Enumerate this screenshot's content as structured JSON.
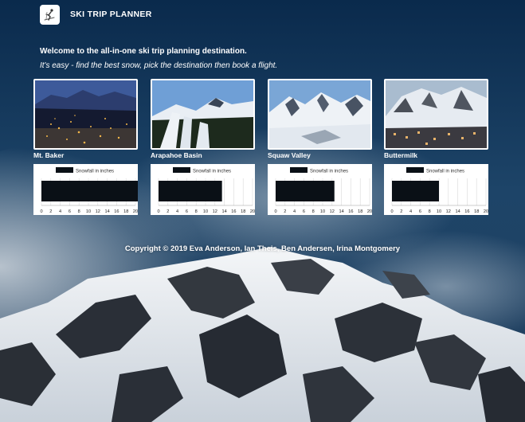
{
  "header": {
    "brand": "SKI TRIP PLANNER",
    "logo_icon": "skier-icon"
  },
  "intro": {
    "line1": "Welcome to the all-in-one ski trip planning destination.",
    "line2": "It's easy - find the best snow, pick the destination then book a flight."
  },
  "resorts": [
    {
      "name": "Mt. Baker",
      "scene": "night-town"
    },
    {
      "name": "Arapahoe Basin",
      "scene": "ski-runs"
    },
    {
      "name": "Squaw Valley",
      "scene": "snowy-valley"
    },
    {
      "name": "Buttermilk",
      "scene": "mountain-town"
    }
  ],
  "chart_data": [
    {
      "type": "bar",
      "orientation": "horizontal",
      "title": "",
      "series": [
        {
          "name": "Snowfall in inches",
          "values": [
            21
          ]
        }
      ],
      "xlim": [
        0,
        20
      ],
      "xticks": [
        0,
        2,
        4,
        6,
        8,
        10,
        12,
        14,
        16,
        18,
        20
      ],
      "grid": true,
      "legend": "top",
      "color": "#0a1016"
    },
    {
      "type": "bar",
      "orientation": "horizontal",
      "title": "",
      "series": [
        {
          "name": "Snowfall in inches",
          "values": [
            13.5
          ]
        }
      ],
      "xlim": [
        0,
        20
      ],
      "xticks": [
        0,
        2,
        4,
        6,
        8,
        10,
        12,
        14,
        16,
        18,
        20
      ],
      "grid": true,
      "legend": "top",
      "color": "#0a1016"
    },
    {
      "type": "bar",
      "orientation": "horizontal",
      "title": "",
      "series": [
        {
          "name": "Snowfall in inches",
          "values": [
            12.5
          ]
        }
      ],
      "xlim": [
        0,
        20
      ],
      "xticks": [
        0,
        2,
        4,
        6,
        8,
        10,
        12,
        14,
        16,
        18,
        20
      ],
      "grid": true,
      "legend": "top",
      "color": "#0a1016"
    },
    {
      "type": "bar",
      "orientation": "horizontal",
      "title": "",
      "series": [
        {
          "name": "Snowfall in inches",
          "values": [
            10
          ]
        }
      ],
      "xlim": [
        0,
        20
      ],
      "xticks": [
        0,
        2,
        4,
        6,
        8,
        10,
        12,
        14,
        16,
        18,
        20
      ],
      "grid": true,
      "legend": "top",
      "color": "#0a1016"
    }
  ],
  "footer": {
    "copyright": "Copyright © 2019 Eva Anderson, Ian Theis, Ben Andersen, Irina Montgomery"
  }
}
